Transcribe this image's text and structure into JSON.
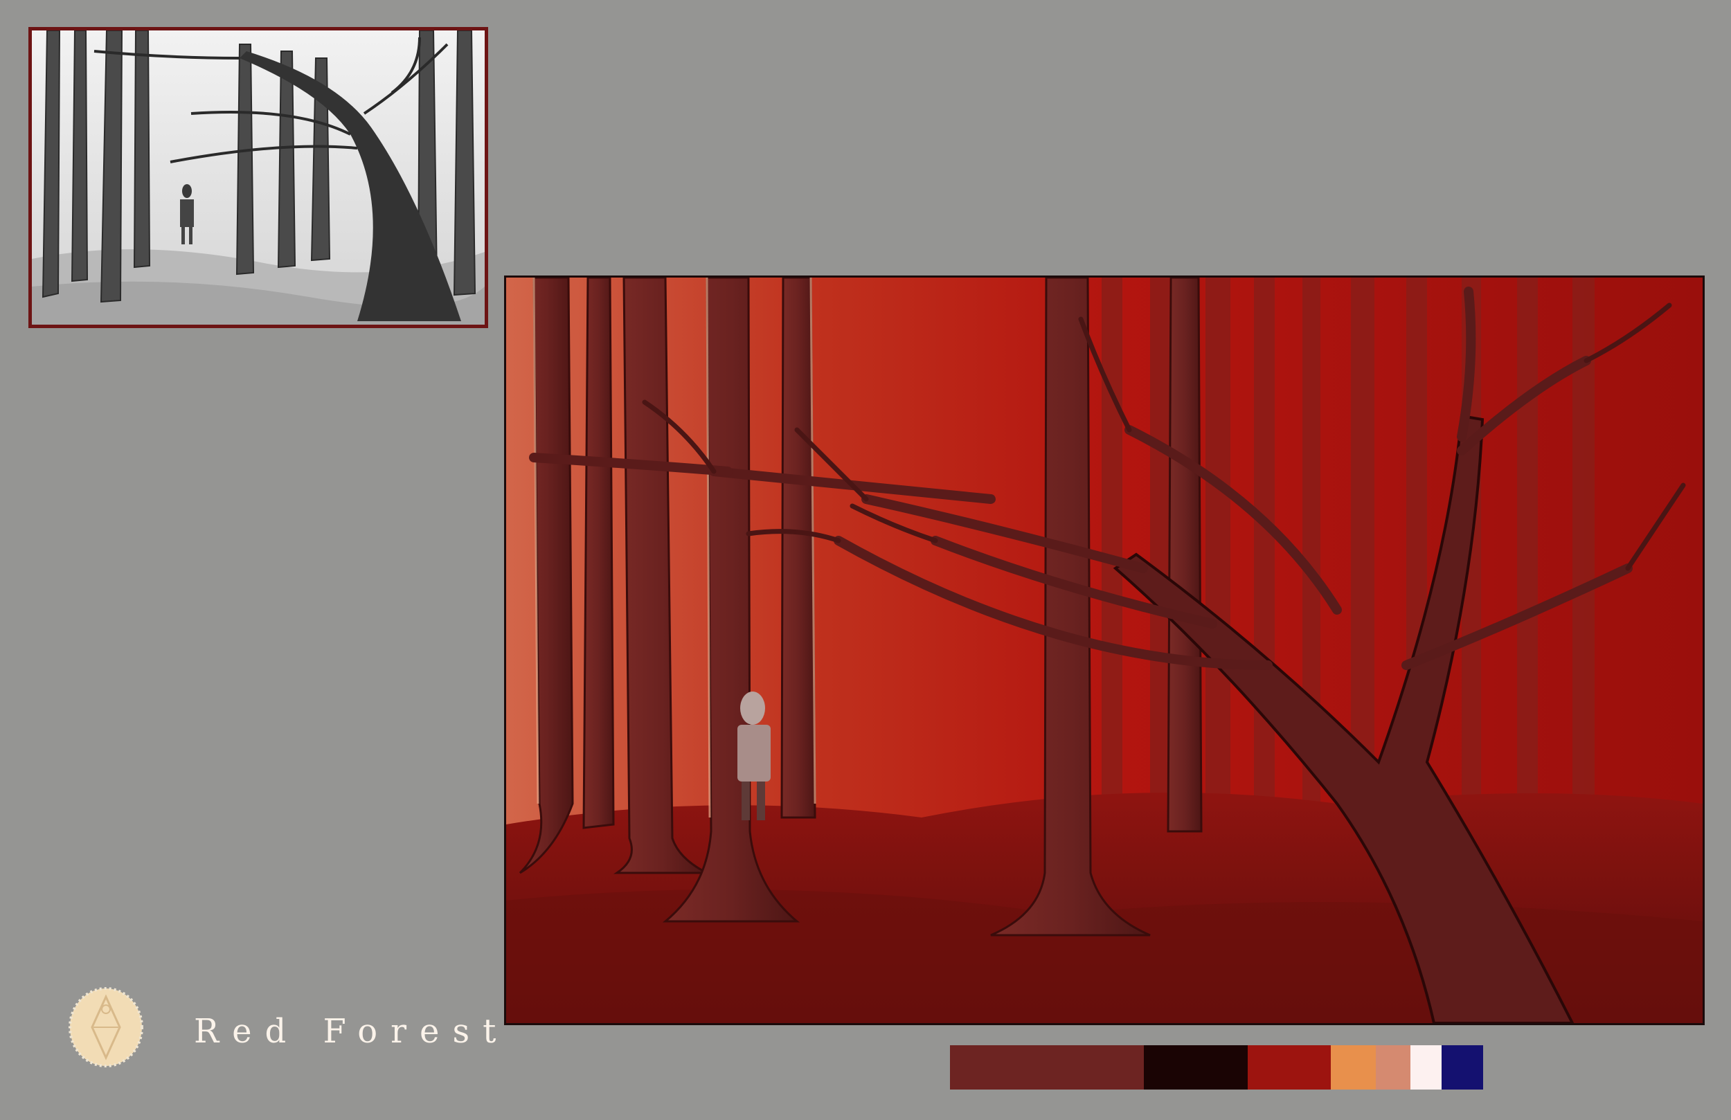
{
  "title": "Red Forest",
  "colors": {
    "background": "#959593",
    "frame_border": "#6d1414",
    "painting_red": "#a81a14",
    "trunk": "#6a2524",
    "title_text": "#fbf3ea",
    "logo": "#f7dfb6"
  },
  "palette": [
    {
      "color": "#6d2422",
      "weight": 2.8
    },
    {
      "color": "#1a0404",
      "weight": 1.5
    },
    {
      "color": "#9d140f",
      "weight": 1.2
    },
    {
      "color": "#e8904c",
      "weight": 0.65
    },
    {
      "color": "#d58a70",
      "weight": 0.5
    },
    {
      "color": "#fdf1f0",
      "weight": 0.45
    },
    {
      "color": "#141170",
      "weight": 0.6
    }
  ],
  "icons": {
    "logo": "diamond-crest-icon"
  }
}
